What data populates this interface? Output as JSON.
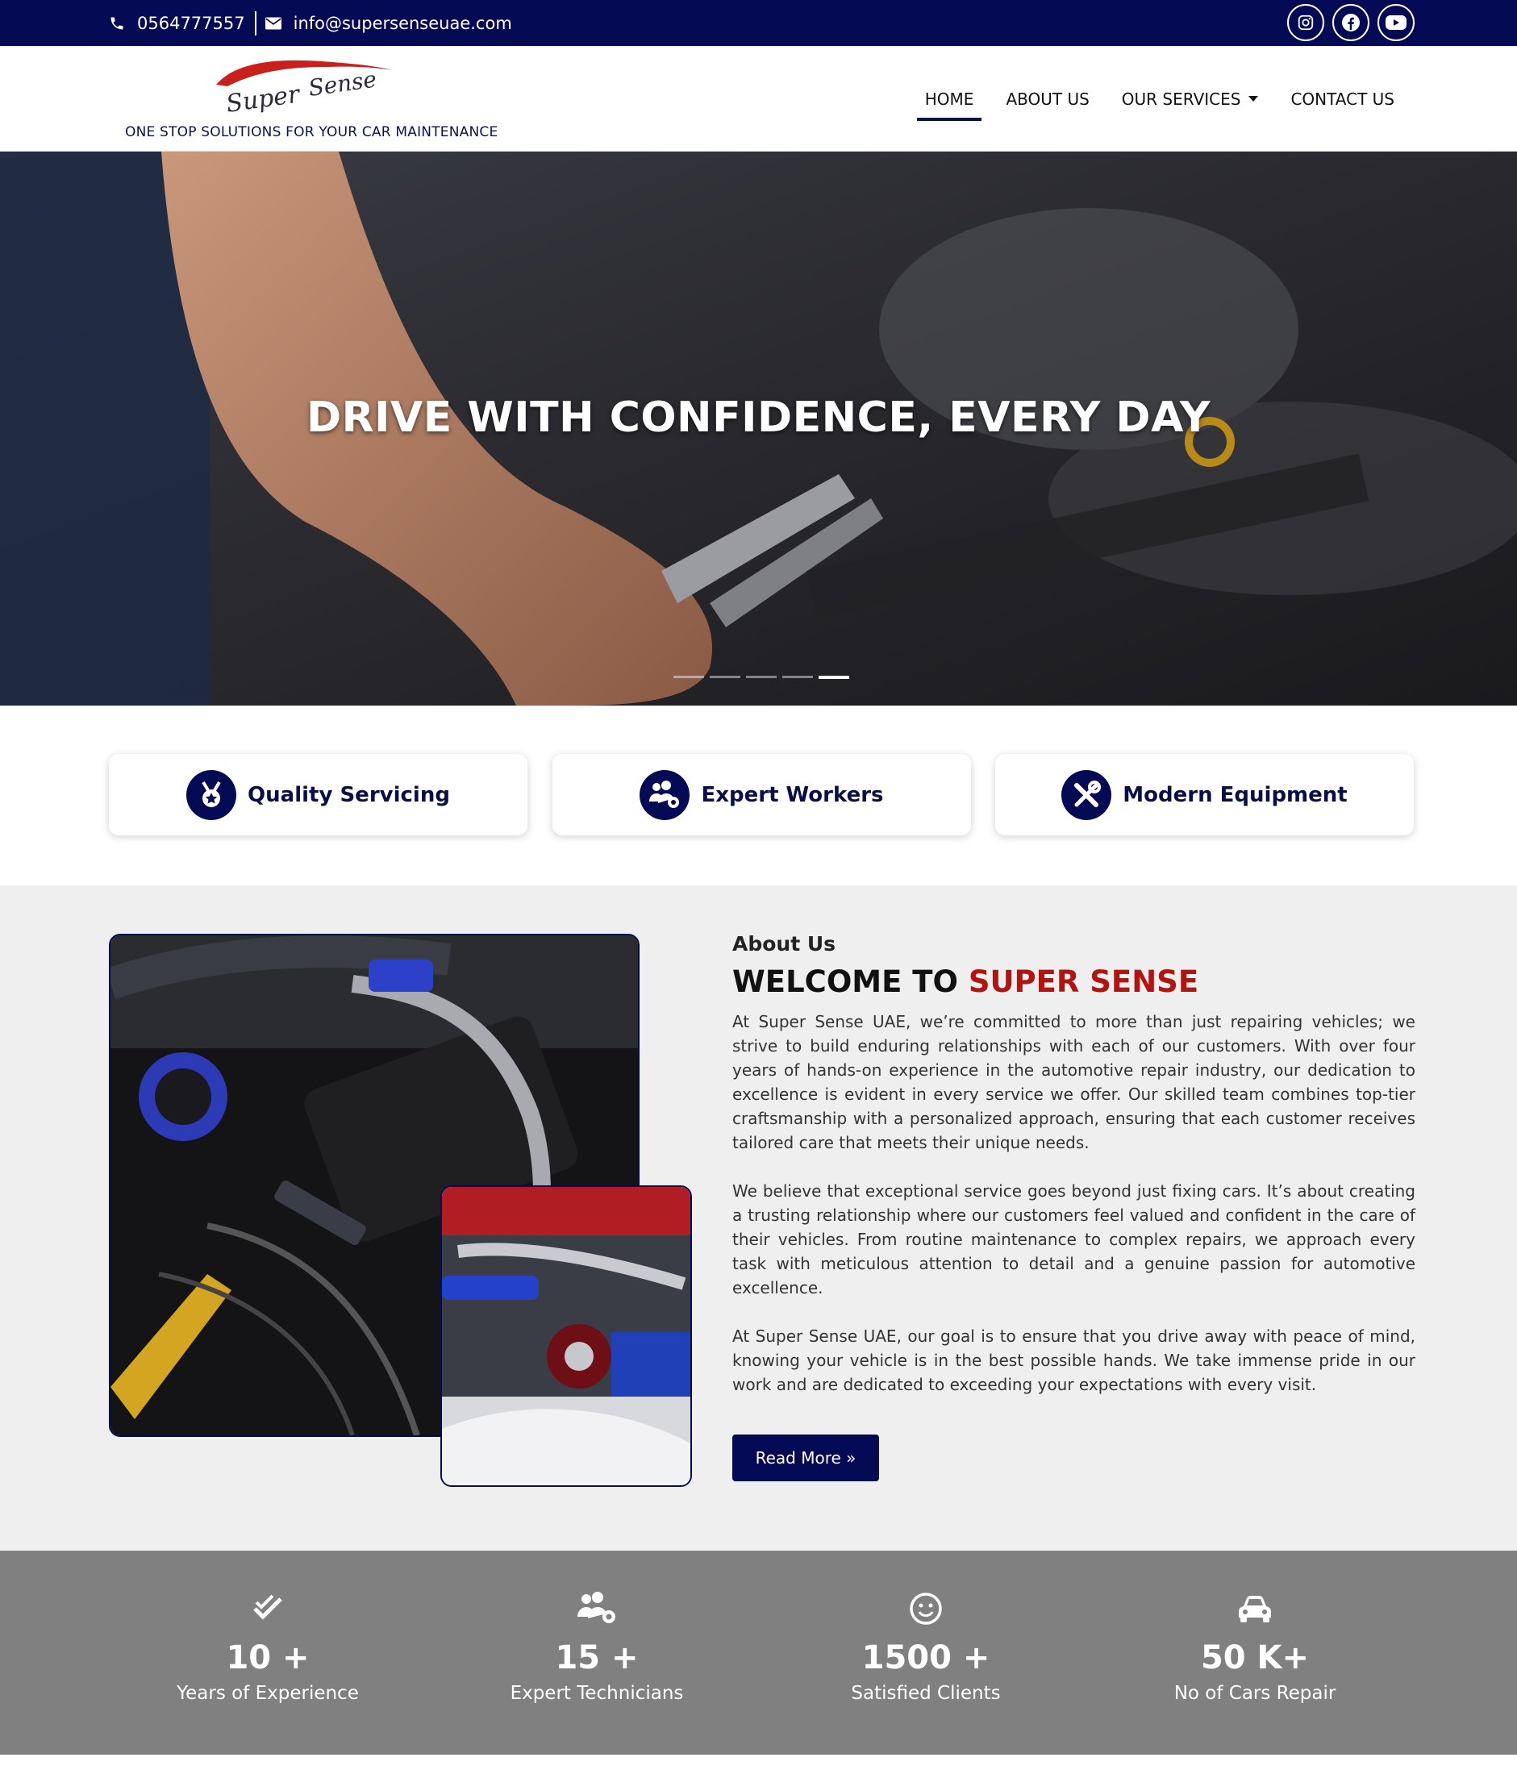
{
  "topbar": {
    "phone": "0564777557",
    "email": "info@supersenseuae.com",
    "social": [
      "instagram-icon",
      "facebook-icon",
      "youtube-icon"
    ]
  },
  "header": {
    "logo_text": "Super Sense",
    "tagline": "ONE STOP SOLUTIONS FOR YOUR CAR MAINTENANCE",
    "nav": {
      "home": "HOME",
      "about": "ABOUT US",
      "services": "OUR SERVICES",
      "contact": "CONTACT US"
    }
  },
  "hero": {
    "title": "DRIVE WITH CONFIDENCE, EVERY DAY",
    "slides": 5,
    "active_slide": 5
  },
  "features": [
    {
      "label": "Quality Servicing",
      "icon": "medal-star-icon"
    },
    {
      "label": "Expert Workers",
      "icon": "users-gear-icon"
    },
    {
      "label": "Modern Equipment",
      "icon": "tools-icon"
    }
  ],
  "about": {
    "eyebrow": "About Us",
    "heading_prefix": "WELCOME TO ",
    "heading_highlight": "SUPER SENSE",
    "p1": "At Super Sense UAE, we’re committed to more than just repairing vehicles; we strive to build enduring relationships with each of our customers. With over four years of hands-on experience in the automotive repair industry, our dedication to excellence is evident in every service we offer. Our skilled team combines top-tier craftsmanship with a personalized approach, ensuring that each customer receives tailored care that meets their unique needs.",
    "p2": "We believe that exceptional service goes beyond just fixing cars. It’s about creating a trusting relationship where our customers feel valued and confident in the care of their vehicles. From routine maintenance to complex repairs, we approach every task with meticulous attention to detail and a genuine passion for automotive excellence.",
    "p3": "At Super Sense UAE, our goal is to ensure that you drive away with peace of mind, knowing your vehicle is in the best possible hands. We take immense pride in our work and are dedicated to exceeding your expectations with every visit.",
    "button": "Read More »"
  },
  "stats": [
    {
      "value": "10 +",
      "label": "Years of Experience",
      "icon": "check-double-icon"
    },
    {
      "value": "15 +",
      "label": "Expert Technicians",
      "icon": "users-gear-icon"
    },
    {
      "value": "1500 +",
      "label": "Satisfied Clients",
      "icon": "smile-icon"
    },
    {
      "value": "50 K+",
      "label": "No of Cars Repair",
      "icon": "car-icon"
    }
  ],
  "colors": {
    "navy": "#050a55",
    "accent_red": "#b4140f",
    "stats_bg": "#808080",
    "about_bg": "#efefef"
  }
}
